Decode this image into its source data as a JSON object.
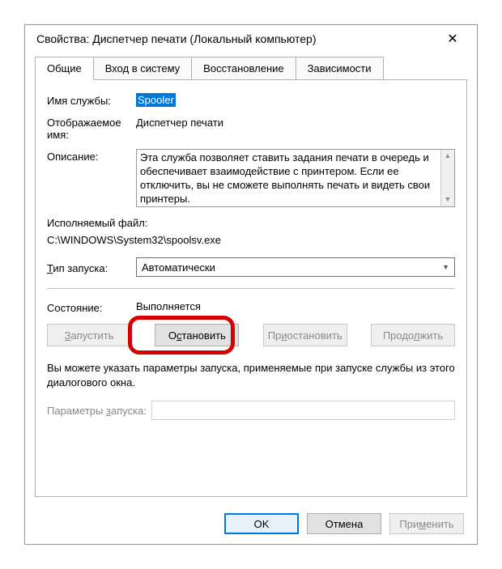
{
  "title": "Свойства: Диспетчер печати (Локальный компьютер)",
  "tabs": {
    "general": "Общие",
    "logon": "Вход в систему",
    "recovery": "Восстановление",
    "deps": "Зависимости"
  },
  "labels": {
    "service_name": "Имя службы:",
    "display_name_1": "Отображаемое",
    "display_name_2": "имя:",
    "description": "Описание:",
    "executable": "Исполняемый файл:",
    "startup_type": "Тип запуска:",
    "state": "Состояние:",
    "params_lbl": "Параметры запуска:"
  },
  "values": {
    "service_name": "Spooler",
    "display_name": "Диспетчер печати",
    "description": "Эта служба позволяет ставить задания печати в очередь и обеспечивает взаимодействие с принтером. Если ее отключить, вы не сможете выполнять печать и видеть свои принтеры.",
    "executable_path": "C:\\WINDOWS\\System32\\spoolsv.exe",
    "startup_type": "Автоматически",
    "state": "Выполняется"
  },
  "buttons": {
    "start": "Запустить",
    "stop": "Остановить",
    "pause": "Приостановить",
    "resume": "Продолжить"
  },
  "note": "Вы можете указать параметры запуска, применяемые при запуске службы из этого диалогового окна.",
  "footer": {
    "ok": "OK",
    "cancel": "Отмена",
    "apply": "Применить"
  }
}
